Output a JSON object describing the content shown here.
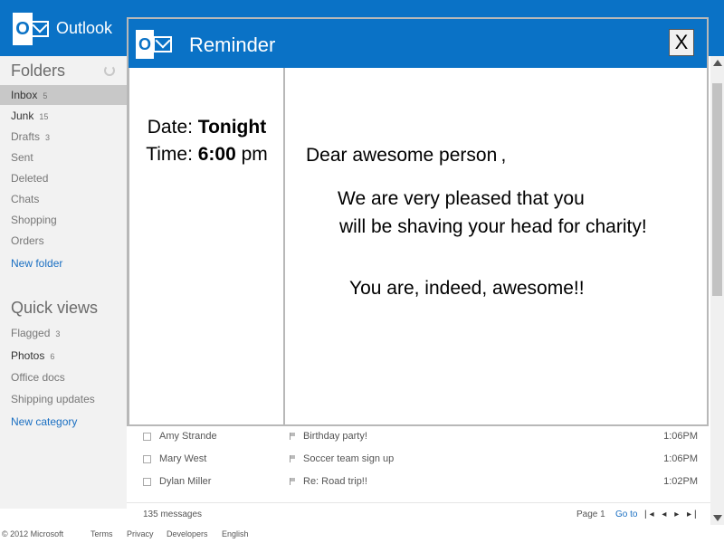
{
  "app": {
    "name": "Outlook",
    "logo_letter": "O"
  },
  "sidebar": {
    "folders_heading": "Folders",
    "items": [
      {
        "label": "Inbox",
        "count": "5"
      },
      {
        "label": "Junk",
        "count": "15"
      },
      {
        "label": "Drafts",
        "count": "3"
      },
      {
        "label": "Sent",
        "count": ""
      },
      {
        "label": "Deleted",
        "count": ""
      },
      {
        "label": "Chats",
        "count": ""
      },
      {
        "label": "Shopping",
        "count": ""
      },
      {
        "label": "Orders",
        "count": ""
      }
    ],
    "new_folder": "New folder",
    "quick_views_heading": "Quick views",
    "quick_views": [
      {
        "label": "Flagged",
        "count": "3"
      },
      {
        "label": "Photos",
        "count": "6"
      },
      {
        "label": "Office docs",
        "count": ""
      },
      {
        "label": "Shipping updates",
        "count": ""
      }
    ],
    "new_category": "New category"
  },
  "messages": [
    {
      "sender": "Amy Strande",
      "subject": "Birthday party!",
      "time": "1:06PM"
    },
    {
      "sender": "Mary West",
      "subject": "Soccer team sign up",
      "time": "1:06PM"
    },
    {
      "sender": "Dylan Miller",
      "subject": "Re: Road trip!!",
      "time": "1:02PM"
    }
  ],
  "list_footer": {
    "count": "135 messages",
    "page": "Page 1",
    "goto": "Go to",
    "pager": "|◂ ◂ ▸ ▸|"
  },
  "footer": {
    "copyright": "© 2012 Microsoft",
    "terms": "Terms",
    "privacy": "Privacy",
    "developers": "Developers",
    "language": "English"
  },
  "dialog": {
    "title": "Reminder",
    "close_label": "X",
    "date_label": "Date: ",
    "date_value": "Tonight",
    "time_label": "Time: ",
    "time_value": "6:00",
    "time_suffix": " pm",
    "greeting": "Dear awesome person ,",
    "line1": "We are very pleased that you",
    "line2": "will be shaving your head for charity!",
    "line3": "You are, indeed, awesome!!"
  },
  "colors": {
    "brand_blue": "#0a72c6",
    "link_blue": "#1a6fc2"
  }
}
